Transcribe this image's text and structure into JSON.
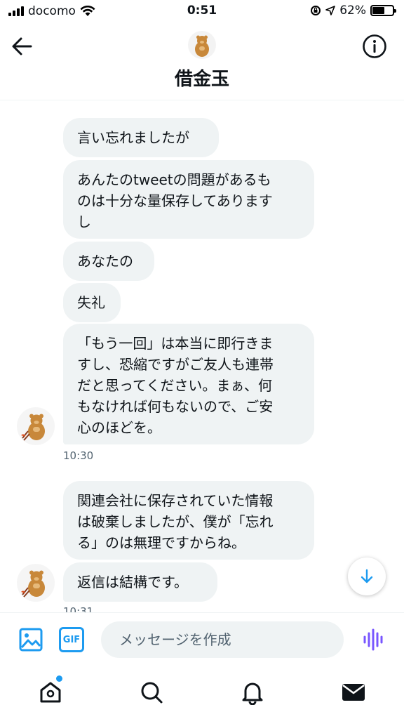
{
  "status_bar": {
    "carrier": "docomo",
    "time": "0:51",
    "battery": "62%",
    "battery_level": 0.62
  },
  "header": {
    "title": "借金玉",
    "back_icon": "arrow-left-icon",
    "info_icon": "info-icon"
  },
  "messages": [
    {
      "text": "言い忘れましたが"
    },
    {
      "text": "あんたのtweetの問題があるも\nのは十分な量保存してあります\nし"
    },
    {
      "text": "あなたの"
    },
    {
      "text": "失礼"
    },
    {
      "text": "「もう一回」は本当に即行きま\nすし、恐縮ですがご友人も連帯\nだと思ってください。まぁ、何\nもなければ何もないので、ご安\n心のほどを。"
    },
    {
      "text": "関連会社に保存されていた情報\nは破棄しましたが、僕が「忘れ\nる」のは無理ですからね。"
    },
    {
      "text": "返信は結構です。"
    }
  ],
  "timestamps": [
    "10:30",
    "10:31"
  ],
  "composer": {
    "placeholder": "メッセージを作成",
    "gif_label": "GIF",
    "image_icon": "image-icon",
    "voice_icon": "voice-wave-icon"
  },
  "tabbar": {
    "icons": [
      "home-icon",
      "search-icon",
      "notifications-icon",
      "messages-icon"
    ]
  },
  "colors": {
    "accent": "#1d9bf0",
    "bubble": "#eff3f4",
    "voice": "#7856ff"
  }
}
